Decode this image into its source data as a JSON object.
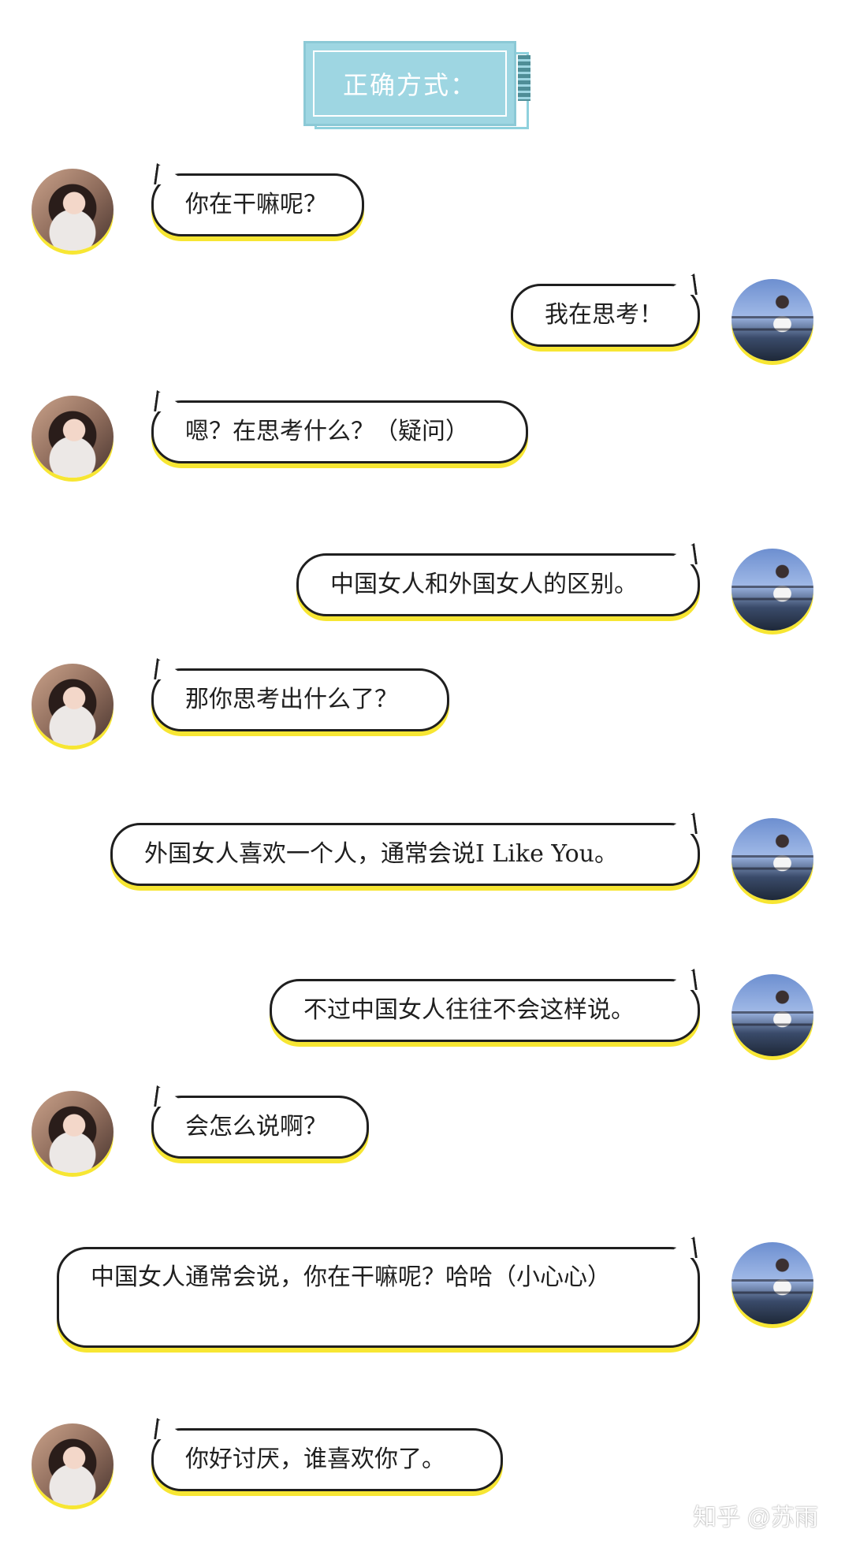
{
  "title": "正确方式：",
  "messages": [
    {
      "speaker": "her",
      "text": "你在干嘛呢？"
    },
    {
      "speaker": "him",
      "text": "我在思考！"
    },
    {
      "speaker": "her",
      "text": "嗯？在思考什么？（疑问）"
    },
    {
      "speaker": "him",
      "text": "中国女人和外国女人的区别。"
    },
    {
      "speaker": "her",
      "text": "那你思考出什么了？"
    },
    {
      "speaker": "him",
      "text": "外国女人喜欢一个人，通常会说I Like You。"
    },
    {
      "speaker": "him",
      "text": "不过中国女人往往不会这样说。"
    },
    {
      "speaker": "her",
      "text": "会怎么说啊？"
    },
    {
      "speaker": "him",
      "text": "中国女人通常会说，你在干嘛呢？哈哈（小心心）"
    },
    {
      "speaker": "her",
      "text": "你好讨厌，谁喜欢你了。"
    }
  ],
  "watermark": "知乎 @苏雨",
  "colors": {
    "accent_yellow": "#f7e633",
    "banner_blue": "#9ed6e2",
    "banner_stripe": "#4f8e97",
    "outline": "#1f1f1f"
  }
}
